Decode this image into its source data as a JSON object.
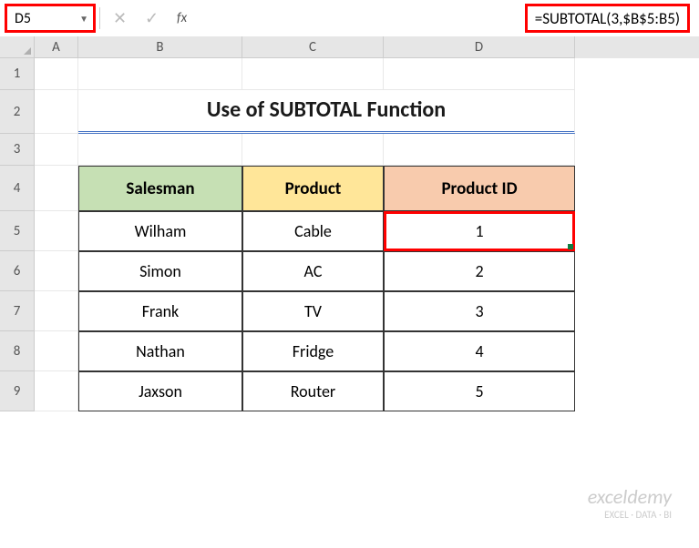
{
  "formula_bar": {
    "cell_ref": "D5",
    "formula": "=SUBTOTAL(3,$B$5:B5)"
  },
  "columns": {
    "a": "A",
    "b": "B",
    "c": "C",
    "d": "D"
  },
  "rows": {
    "r1": "1",
    "r2": "2",
    "r3": "3",
    "r4": "4",
    "r5": "5",
    "r6": "6",
    "r7": "7",
    "r8": "8",
    "r9": "9"
  },
  "title": "Use of SUBTOTAL Function",
  "headers": {
    "salesman": "Salesman",
    "product": "Product",
    "product_id": "Product ID"
  },
  "data": [
    {
      "salesman": "Wilham",
      "product": "Cable",
      "id": "1"
    },
    {
      "salesman": "Simon",
      "product": "AC",
      "id": "2"
    },
    {
      "salesman": "Frank",
      "product": "TV",
      "id": "3"
    },
    {
      "salesman": "Nathan",
      "product": "Fridge",
      "id": "4"
    },
    {
      "salesman": "Jaxson",
      "product": "Router",
      "id": "5"
    }
  ],
  "watermark": {
    "brand": "exceldemy",
    "tag": "EXCEL · DATA · BI"
  },
  "chart_data": {
    "type": "table",
    "title": "Use of SUBTOTAL Function",
    "columns": [
      "Salesman",
      "Product",
      "Product ID"
    ],
    "rows": [
      [
        "Wilham",
        "Cable",
        1
      ],
      [
        "Simon",
        "AC",
        2
      ],
      [
        "Frank",
        "TV",
        3
      ],
      [
        "Nathan",
        "Fridge",
        4
      ],
      [
        "Jaxson",
        "Router",
        5
      ]
    ]
  }
}
